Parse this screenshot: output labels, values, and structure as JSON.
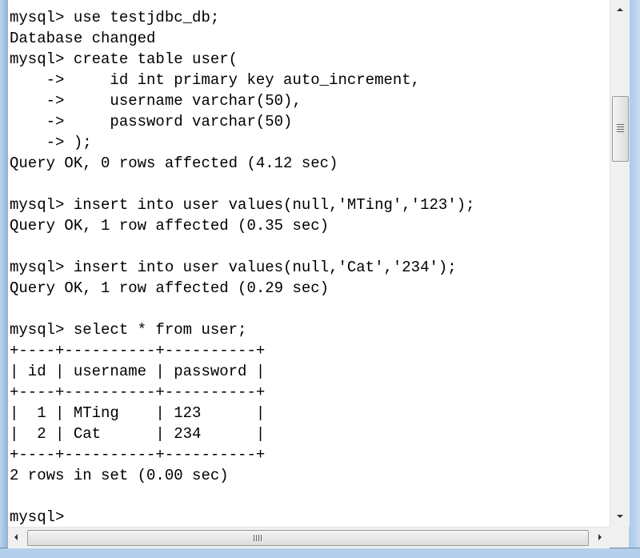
{
  "console": {
    "lines": [
      "mysql> use testjdbc_db;",
      "Database changed",
      "mysql> create table user(",
      "    ->     id int primary key auto_increment,",
      "    ->     username varchar(50),",
      "    ->     password varchar(50)",
      "    -> );",
      "Query OK, 0 rows affected (4.12 sec)",
      "",
      "mysql> insert into user values(null,'MTing','123');",
      "Query OK, 1 row affected (0.35 sec)",
      "",
      "mysql> insert into user values(null,'Cat','234');",
      "Query OK, 1 row affected (0.29 sec)",
      "",
      "mysql> select * from user;",
      "+----+----------+----------+",
      "| id | username | password |",
      "+----+----------+----------+",
      "|  1 | MTing    | 123      |",
      "|  2 | Cat      | 234      |",
      "+----+----------+----------+",
      "2 rows in set (0.00 sec)",
      "",
      "mysql>"
    ]
  },
  "scrollbars": {
    "up_icon": "arrow-up-icon",
    "down_icon": "arrow-down-icon",
    "left_icon": "arrow-left-icon",
    "right_icon": "arrow-right-icon"
  }
}
